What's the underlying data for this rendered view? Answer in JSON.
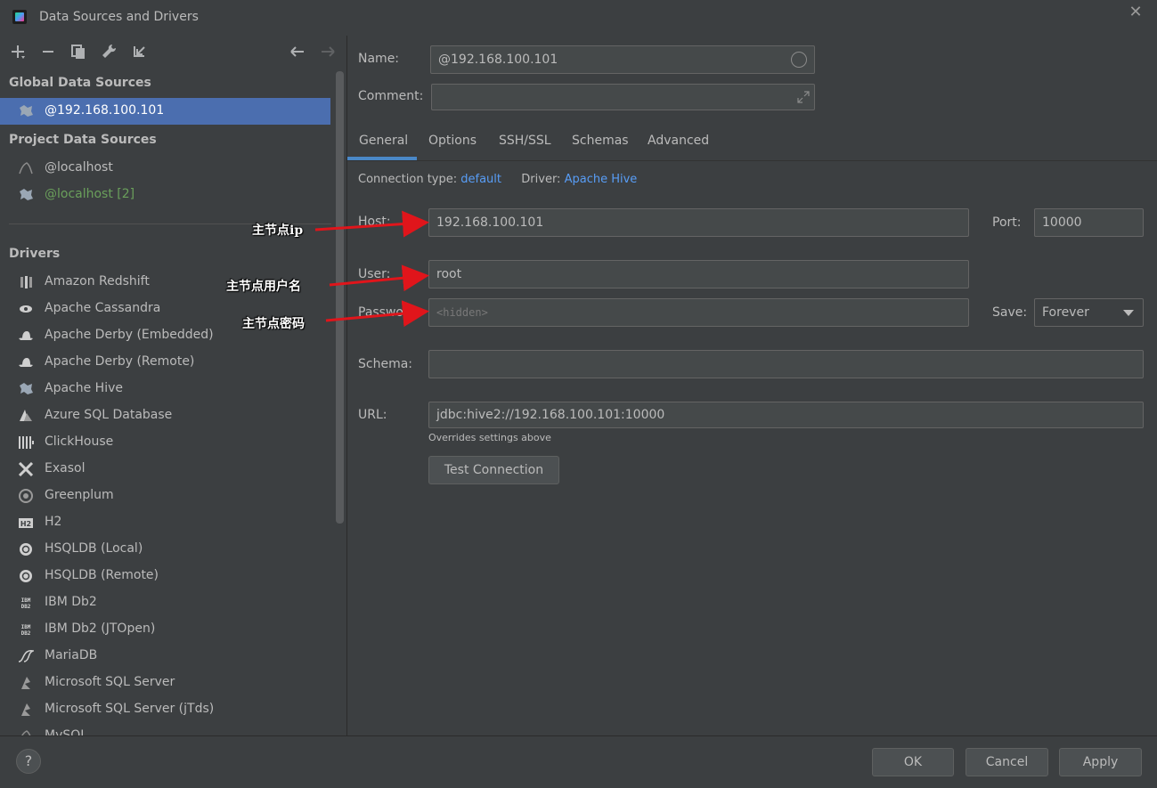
{
  "window": {
    "title": "Data Sources and Drivers"
  },
  "left_panel": {
    "global_section": "Global Data Sources",
    "global_items": [
      {
        "label": "@192.168.100.101",
        "selected": true
      }
    ],
    "project_section": "Project Data Sources",
    "project_items": [
      {
        "label": "@localhost"
      },
      {
        "label": "@localhost [2]"
      }
    ],
    "drivers_section": "Drivers",
    "drivers": [
      "Amazon Redshift",
      "Apache Cassandra",
      "Apache Derby (Embedded)",
      "Apache Derby (Remote)",
      "Apache Hive",
      "Azure SQL Database",
      "ClickHouse",
      "Exasol",
      "Greenplum",
      "H2",
      "HSQLDB (Local)",
      "HSQLDB (Remote)",
      "IBM Db2",
      "IBM Db2 (JTOpen)",
      "MariaDB",
      "Microsoft SQL Server",
      "Microsoft SQL Server (jTds)",
      "MySQL"
    ]
  },
  "form": {
    "name_label": "Name:",
    "name_value": "@192.168.100.101",
    "comment_label": "Comment:",
    "comment_value": "",
    "tabs": [
      "General",
      "Options",
      "SSH/SSL",
      "Schemas",
      "Advanced"
    ],
    "active_tab": "General",
    "connection_type_label": "Connection type:",
    "connection_type_value": "default",
    "driver_label": "Driver:",
    "driver_value": "Apache Hive",
    "host_label": "Host:",
    "host_value": "192.168.100.101",
    "port_label": "Port:",
    "port_value": "10000",
    "user_label": "User:",
    "user_value": "root",
    "password_label": "Password:",
    "password_placeholder": "<hidden>",
    "save_label": "Save:",
    "save_value": "Forever",
    "schema_label": "Schema:",
    "schema_value": "",
    "url_label": "URL:",
    "url_value": "jdbc:hive2://192.168.100.101:10000",
    "url_hint": "Overrides settings above",
    "test_connection": "Test Connection"
  },
  "footer": {
    "help": "?",
    "ok": "OK",
    "cancel": "Cancel",
    "apply": "Apply"
  },
  "annotations": {
    "host_note": "主节点ip",
    "user_note": "主节点用户名",
    "password_note": "主节点密码"
  },
  "colors": {
    "background": "#3c3f41",
    "selection": "#4b6eaf",
    "link": "#589df6",
    "tab_underline": "#4a88c7",
    "annotation_arrow": "#e0151b",
    "green_item": "#6a9f5b"
  }
}
